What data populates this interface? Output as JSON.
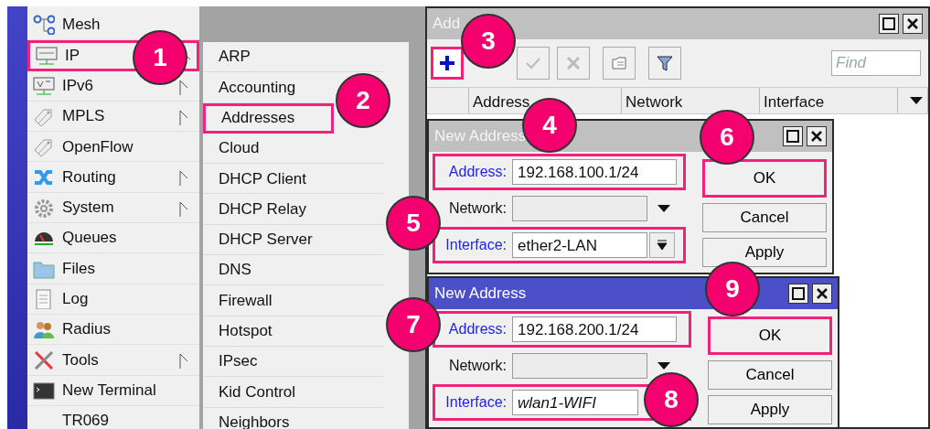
{
  "menu": {
    "items": [
      {
        "label": "Mesh",
        "has_submenu": false,
        "highlighted": false
      },
      {
        "label": "IP",
        "has_submenu": true,
        "highlighted": true
      },
      {
        "label": "IPv6",
        "has_submenu": true,
        "highlighted": false
      },
      {
        "label": "MPLS",
        "has_submenu": true,
        "highlighted": false
      },
      {
        "label": "OpenFlow",
        "has_submenu": false,
        "highlighted": false
      },
      {
        "label": "Routing",
        "has_submenu": true,
        "highlighted": false
      },
      {
        "label": "System",
        "has_submenu": true,
        "highlighted": false
      },
      {
        "label": "Queues",
        "has_submenu": false,
        "highlighted": false
      },
      {
        "label": "Files",
        "has_submenu": false,
        "highlighted": false
      },
      {
        "label": "Log",
        "has_submenu": false,
        "highlighted": false
      },
      {
        "label": "Radius",
        "has_submenu": false,
        "highlighted": false
      },
      {
        "label": "Tools",
        "has_submenu": true,
        "highlighted": false
      },
      {
        "label": "New Terminal",
        "has_submenu": false,
        "highlighted": false
      },
      {
        "label": "TR069",
        "has_submenu": false,
        "highlighted": false
      }
    ]
  },
  "submenu": {
    "items": [
      {
        "label": "ARP",
        "highlighted": false
      },
      {
        "label": "Accounting",
        "highlighted": false
      },
      {
        "label": "Addresses",
        "highlighted": true
      },
      {
        "label": "Cloud",
        "highlighted": false
      },
      {
        "label": "DHCP Client",
        "highlighted": false
      },
      {
        "label": "DHCP Relay",
        "highlighted": false
      },
      {
        "label": "DHCP Server",
        "highlighted": false
      },
      {
        "label": "DNS",
        "highlighted": false
      },
      {
        "label": "Firewall",
        "highlighted": false
      },
      {
        "label": "Hotspot",
        "highlighted": false
      },
      {
        "label": "IPsec",
        "highlighted": false
      },
      {
        "label": "Kid Control",
        "highlighted": false
      },
      {
        "label": "Neighbors",
        "highlighted": false
      }
    ]
  },
  "address_list": {
    "title": "Add",
    "toolbar": [
      {
        "kind": "add",
        "highlighted": true
      },
      {
        "kind": "enable",
        "highlighted": false
      },
      {
        "kind": "disable",
        "highlighted": false
      },
      {
        "kind": "comment",
        "highlighted": false
      },
      {
        "kind": "filter",
        "highlighted": false
      }
    ],
    "find_placeholder": "Find",
    "columns": [
      "Address",
      "Network",
      "Interface"
    ]
  },
  "dialogs": [
    {
      "title": "New Address",
      "active": false,
      "fields": [
        {
          "label": "Address:",
          "value": "192.168.100.1/24",
          "kind": "text",
          "highlighted": true,
          "italic": false,
          "blue_label": true
        },
        {
          "label": "Network:",
          "kind": "dropdown",
          "highlighted": false,
          "blue_label": false
        },
        {
          "label": "Interface:",
          "value": "ether2-LAN",
          "kind": "combo",
          "highlighted": true,
          "italic": false,
          "blue_label": true
        }
      ],
      "buttons": [
        {
          "label": "OK",
          "highlighted": true
        },
        {
          "label": "Cancel",
          "highlighted": false
        },
        {
          "label": "Apply",
          "highlighted": false
        }
      ]
    },
    {
      "title": "New Address",
      "active": true,
      "fields": [
        {
          "label": "Address:",
          "value": "192.168.200.1/24",
          "kind": "text",
          "highlighted": true,
          "italic": false,
          "blue_label": true
        },
        {
          "label": "Network:",
          "kind": "dropdown",
          "highlighted": false,
          "blue_label": false
        },
        {
          "label": "Interface:",
          "value": "wlan1-WIFI",
          "kind": "text",
          "highlighted": true,
          "italic": true,
          "blue_label": true
        }
      ],
      "buttons": [
        {
          "label": "OK",
          "highlighted": true
        },
        {
          "label": "Cancel",
          "highlighted": false
        },
        {
          "label": "Apply",
          "highlighted": false
        }
      ]
    }
  ],
  "callouts": [
    "1",
    "2",
    "3",
    "4",
    "5",
    "6",
    "7",
    "8",
    "9"
  ]
}
